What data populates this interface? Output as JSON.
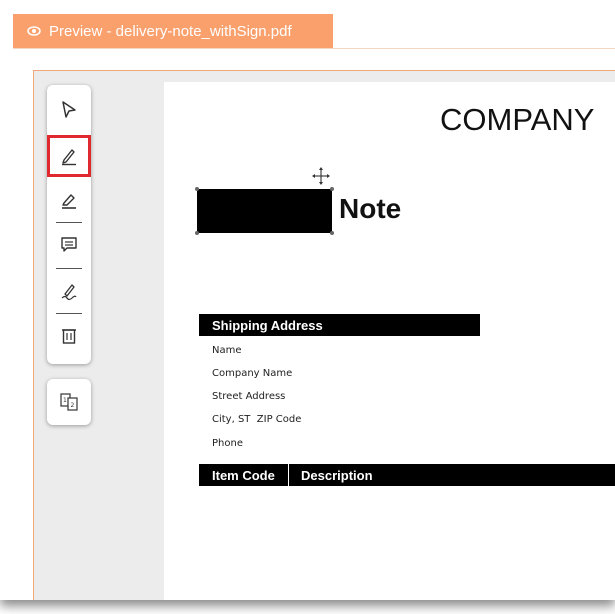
{
  "window": {
    "tab_title": "Preview - delivery-note_withSign.pdf",
    "tab_icon": "eye-icon",
    "accent_color": "#f9a06c",
    "highlight_color": "#e0282f"
  },
  "toolbar": {
    "tools": [
      {
        "name": "select",
        "icon": "cursor-icon",
        "selected": false
      },
      {
        "name": "draw",
        "icon": "pen-icon",
        "selected": true
      },
      {
        "name": "highlight",
        "icon": "highlighter-icon",
        "selected": false
      },
      {
        "name": "comment",
        "icon": "comment-icon",
        "selected": false
      },
      {
        "name": "signature",
        "icon": "signature-icon",
        "selected": false
      },
      {
        "name": "delete",
        "icon": "trash-icon",
        "selected": false
      }
    ],
    "page_button_icon": "pages-icon"
  },
  "document": {
    "company": "COMPANY",
    "title_suffix": "Note",
    "shipping_header": "Shipping Address",
    "address_lines": [
      "Name",
      "Company Name",
      "Street Address",
      "City, ST  ZIP Code",
      "Phone"
    ],
    "item_columns": [
      "Item Code",
      "Description"
    ]
  }
}
